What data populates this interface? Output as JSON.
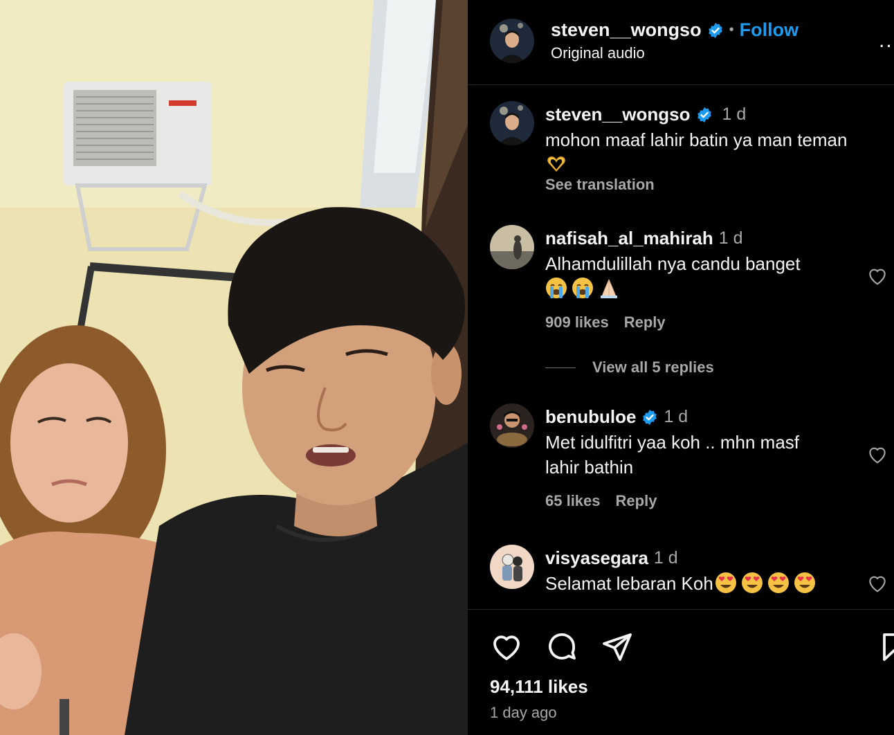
{
  "post": {
    "author": "steven__wongso",
    "follow_label": "Follow",
    "separator": "•",
    "audio": "Original audio",
    "more_label": "..",
    "likes": "94,111 likes",
    "time_ago": "1 day ago"
  },
  "comments": [
    {
      "user": "steven__wongso",
      "verified": true,
      "time": "1 d",
      "text": "mohon maaf lahir batin ya man teman",
      "emojis": [
        "heart-hands-emoji"
      ],
      "see_translation": "See translation"
    },
    {
      "user": "nafisah_al_mahirah",
      "verified": false,
      "time": "1 d",
      "text": "Alhamdulillah nya candu banget",
      "emojis": [
        "loudly-crying-face-emoji",
        "loudly-crying-face-emoji",
        "folded-hands-emoji"
      ],
      "likes": "909 likes",
      "reply_label": "Reply",
      "view_replies": "View all 5 replies"
    },
    {
      "user": "benubuloe",
      "verified": true,
      "time": "1 d",
      "text_line1": "Met idulfitri yaa koh .. mhn masf",
      "text_line2": "lahir bathin",
      "likes": "65 likes",
      "reply_label": "Reply"
    },
    {
      "user": "visyasegara",
      "verified": false,
      "time": "1 d",
      "text": "Selamat lebaran Koh",
      "emojis": [
        "heart-eyes-emoji",
        "heart-eyes-emoji",
        "heart-eyes-emoji",
        "heart-eyes-emoji"
      ]
    }
  ],
  "colors": {
    "background": "#000000",
    "link_blue": "#1d9bf0",
    "muted_text": "#a8a8a8",
    "divider": "#262626"
  },
  "icons": [
    "verified-badge-icon",
    "heart-icon",
    "comment-icon",
    "share-icon",
    "bookmark-icon",
    "more-icon"
  ]
}
